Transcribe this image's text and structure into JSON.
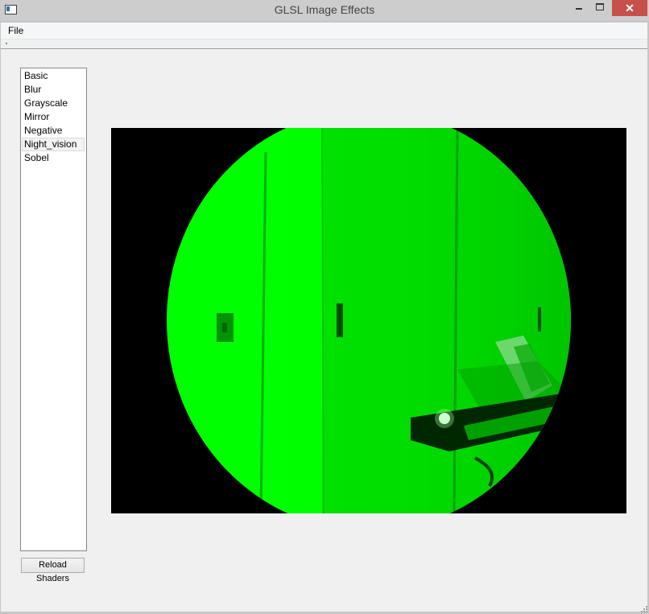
{
  "window": {
    "title": "GLSL Image Effects",
    "close_glyph": "✕"
  },
  "menu": {
    "file": "File"
  },
  "shaders": {
    "items": [
      "Basic",
      "Blur",
      "Grayscale",
      "Mirror",
      "Negative",
      "Night_vision",
      "Sobel"
    ],
    "selected": "Night_vision"
  },
  "buttons": {
    "reload": "Reload Shaders"
  },
  "colors": {
    "night_vision_green": "#00ff00",
    "close_button": "#c7504a"
  }
}
